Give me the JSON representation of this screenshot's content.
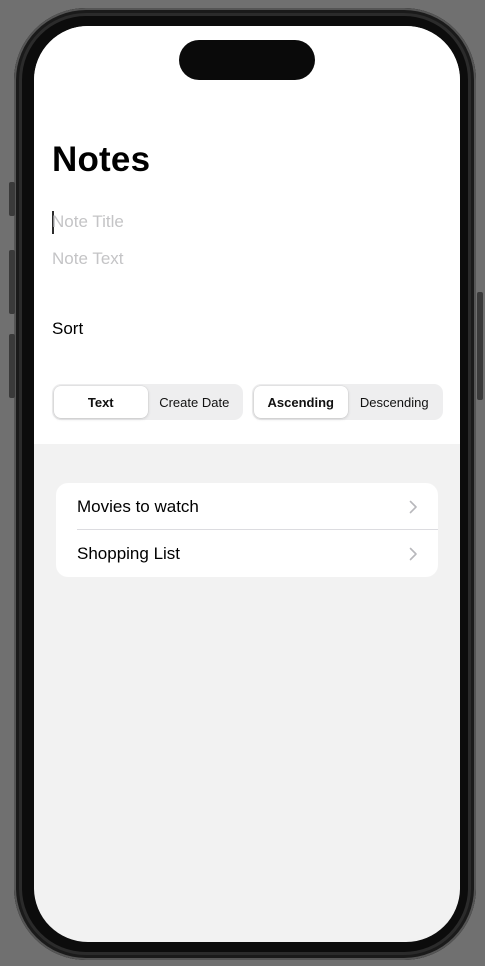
{
  "header": {
    "title": "Notes"
  },
  "form": {
    "title_placeholder": "Note Title",
    "text_placeholder": "Note Text"
  },
  "sort": {
    "label": "Sort",
    "field_options": [
      "Text",
      "Create Date"
    ],
    "field_selected": "Text",
    "order_options": [
      "Ascending",
      "Descending"
    ],
    "order_selected": "Ascending"
  },
  "notes": {
    "items": [
      {
        "label": "Movies to watch"
      },
      {
        "label": "Shopping List"
      }
    ]
  },
  "colors": {
    "background_list": "#f2f2f2",
    "placeholder": "#c4c4c6",
    "segment_bg": "#eeeeef"
  }
}
